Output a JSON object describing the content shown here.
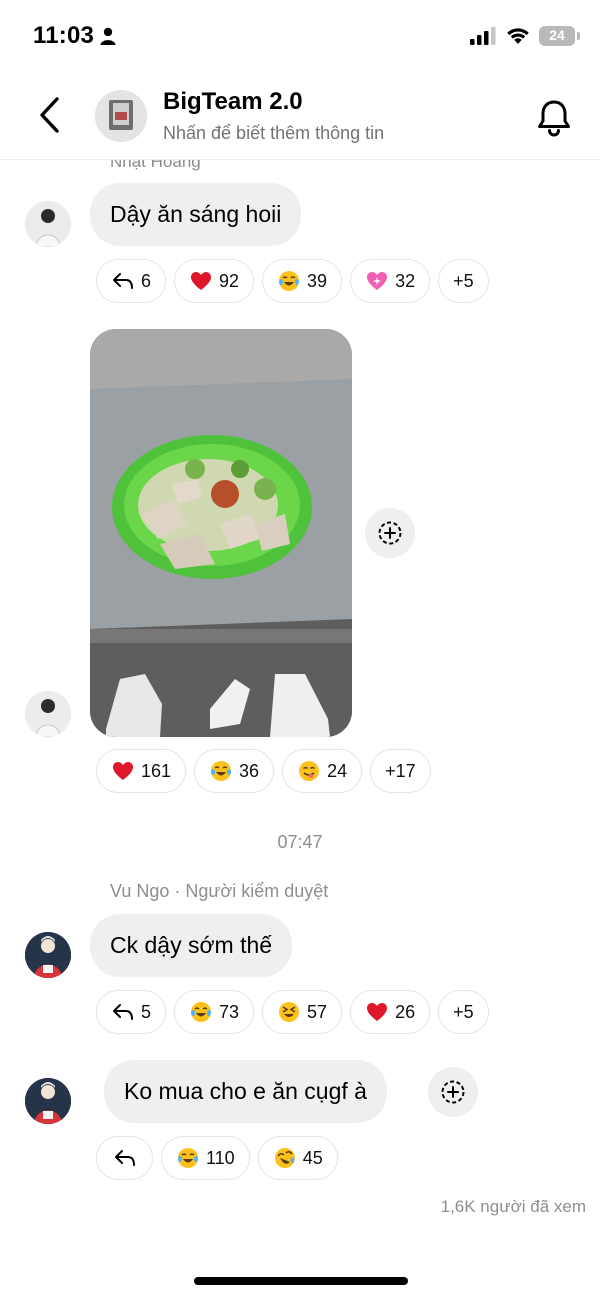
{
  "status_bar": {
    "time": "11:03",
    "battery": "24"
  },
  "header": {
    "title": "BigTeam 2.0",
    "subtitle": "Nhấn để biết thêm thông tin"
  },
  "messages": [
    {
      "sender": "Nhật Hoàng",
      "text": "Dậy ăn sáng hoii",
      "reactions": {
        "reply": "6",
        "heart": "92",
        "laugh": "39",
        "pink_heart": "32",
        "more": "+5"
      }
    },
    {
      "type": "photo",
      "photo_icon": "food-bowl-photo",
      "reactions": {
        "heart": "161",
        "laugh": "36",
        "yum": "24",
        "more": "+17"
      }
    },
    {
      "text": "Ck dậy sớm thế",
      "reactions": {
        "reply": "5",
        "laugh": "73",
        "squint": "57",
        "heart": "26",
        "more": "+5"
      }
    },
    {
      "text": "Ko mua cho e ăn cụgf à",
      "reactions": {
        "laugh": "110",
        "rofl": "45"
      }
    }
  ],
  "timestamp": "07:47",
  "sender_line": "Vu Ngo · Người kiểm duyệt",
  "seen_count": "1,6K người đã xem",
  "colors": {
    "bubble": "#efefef",
    "muted": "#8e8e8e"
  }
}
